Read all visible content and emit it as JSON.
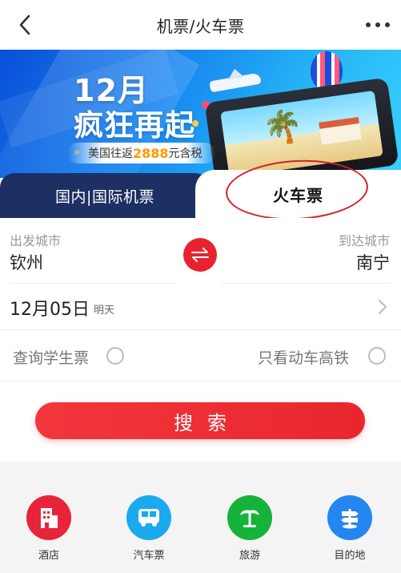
{
  "header": {
    "title": "机票/火车票"
  },
  "banner": {
    "headline_line1": "12月",
    "headline_line2": "疯狂再起",
    "promo_text": "美国往返",
    "promo_price": "2888",
    "promo_suffix": "元含税"
  },
  "tabs": [
    {
      "label": "国内|国际机票",
      "active": false
    },
    {
      "label": "火车票",
      "active": true
    }
  ],
  "form": {
    "depart_label": "出发城市",
    "depart_city": "钦州",
    "arrive_label": "到达城市",
    "arrive_city": "南宁",
    "date": "12月05日",
    "date_note": "明天",
    "option_student": "查询学生票",
    "option_high_speed": "只看动车高铁",
    "search_label": "搜索"
  },
  "bottom_nav": [
    {
      "label": "酒店",
      "icon": "hotel-icon",
      "color": "#e8243a"
    },
    {
      "label": "汽车票",
      "icon": "bus-icon",
      "color": "#1ba9f0"
    },
    {
      "label": "旅游",
      "icon": "palm-tree-icon",
      "color": "#16b33a"
    },
    {
      "label": "目的地",
      "icon": "signpost-icon",
      "color": "#2486f0"
    }
  ],
  "colors": {
    "accent": "#e8232f",
    "tab_dark": "#1d2f63"
  }
}
